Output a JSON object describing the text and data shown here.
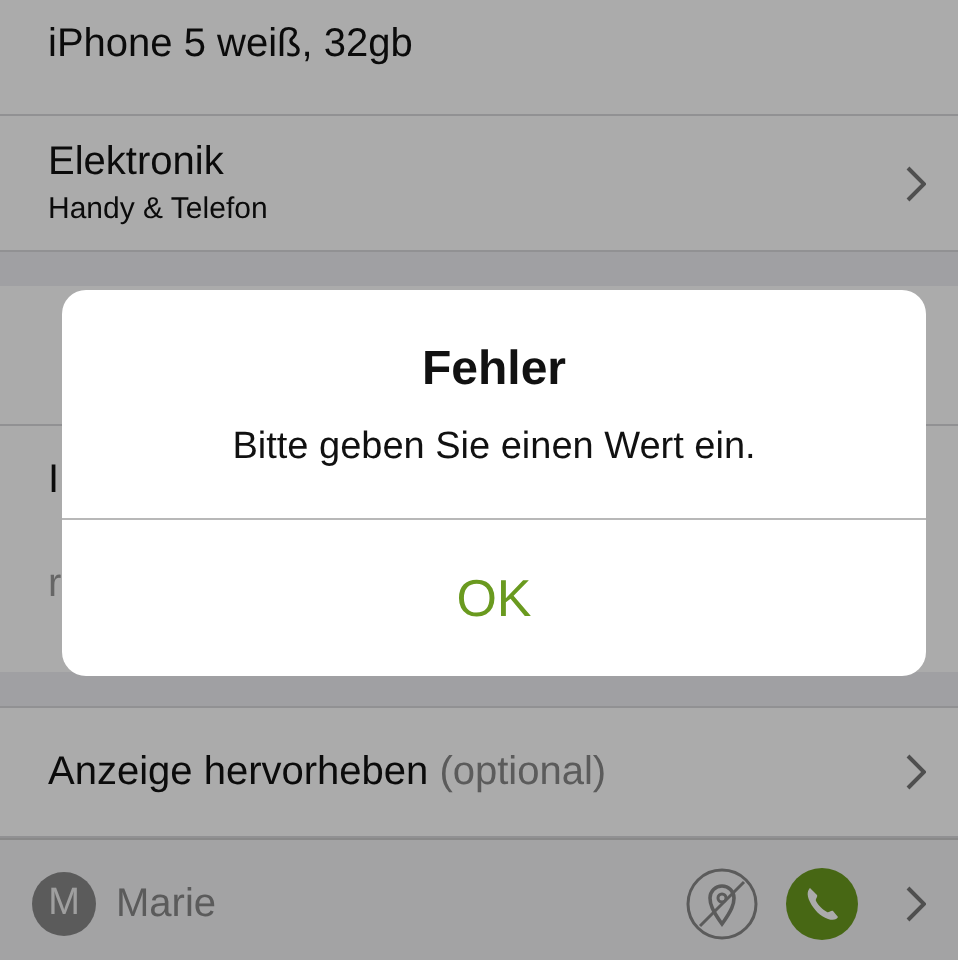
{
  "form": {
    "sections": [
      {
        "rows": [
          {
            "kind": "text",
            "title": "iPhone 5 weiß, 32gb"
          },
          {
            "kind": "category",
            "title": "Elektronik",
            "subtitle": "Handy & Telefon"
          }
        ]
      },
      {
        "rows": [
          {
            "kind": "select"
          },
          {
            "kind": "description",
            "lines": [
              {
                "text": "I",
                "placeholder": false
              },
              {
                "text": "r",
                "placeholder": true
              }
            ]
          }
        ]
      },
      {
        "rows": [
          {
            "kind": "option",
            "title": "Anzeige hervorheben",
            "hint": "(optional)"
          }
        ]
      },
      {
        "rows": [
          {
            "kind": "contact",
            "initial": "M",
            "name": "Marie",
            "location_enabled": false
          }
        ]
      }
    ]
  },
  "alert": {
    "title": "Fehler",
    "message": "Bitte geben Sie einen Wert ein.",
    "buttons": [
      "OK"
    ]
  }
}
